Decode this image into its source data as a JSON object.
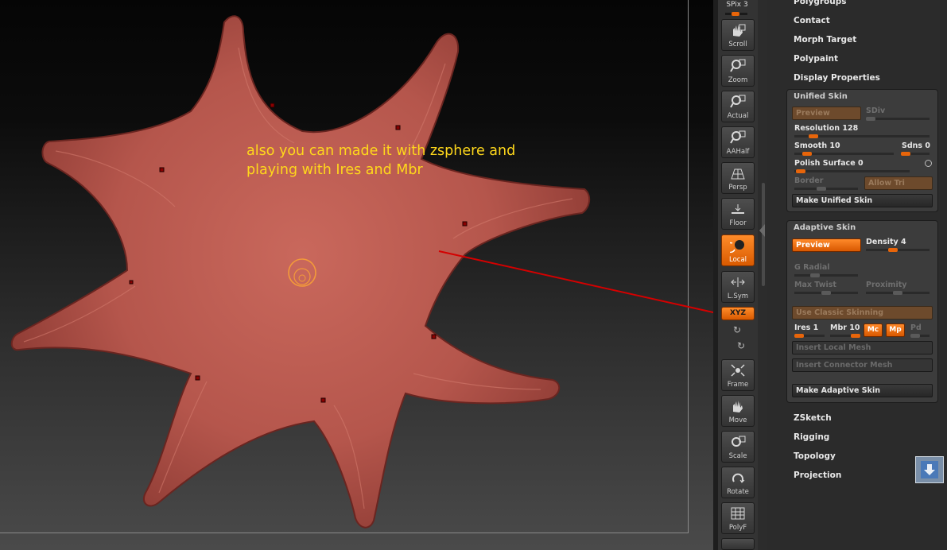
{
  "annotation": {
    "line1": "also you can made it with zsphere and",
    "line2": "playing with Ires and Mbr"
  },
  "colors": {
    "accent_orange": "#e8650a",
    "annotation_yellow": "#ffd81b",
    "arrow_red": "#d40000",
    "mesh_color": "#b5564c"
  },
  "shelf": {
    "spix": "SPix 3",
    "tools": [
      {
        "label": "Scroll",
        "icon": "hand-icon"
      },
      {
        "label": "Zoom",
        "icon": "zoom-icon"
      },
      {
        "label": "Actual",
        "icon": "zoom-icon"
      },
      {
        "label": "AAHalf",
        "icon": "zoom-icon"
      },
      {
        "label": "Persp",
        "icon": "grid-icon"
      },
      {
        "label": "Floor",
        "icon": "floor-icon"
      },
      {
        "label": "Local",
        "icon": "local-icon"
      },
      {
        "label": "L.Sym",
        "icon": "symmetry-icon"
      },
      {
        "label": "Frame",
        "icon": "frame-icon"
      },
      {
        "label": "Move",
        "icon": "hand-icon"
      },
      {
        "label": "Scale",
        "icon": "scale-icon"
      },
      {
        "label": "Rotate",
        "icon": "rotate-icon"
      },
      {
        "label": "PolyF",
        "icon": "polyframe-icon"
      }
    ],
    "xyz": "XYZ"
  },
  "menu_top": [
    "Polygroups",
    "Contact",
    "Morph Target",
    "Polypaint",
    "Display Properties"
  ],
  "unified_skin": {
    "title": "Unified Skin",
    "preview": "Preview",
    "sdiv": "SDiv",
    "resolution": "Resolution 128",
    "smooth": "Smooth 10",
    "sdns": "Sdns 0",
    "polish_surface": "Polish Surface 0",
    "border": "Border",
    "allow_tri": "Allow Tri",
    "make": "Make Unified Skin"
  },
  "adaptive_skin": {
    "title": "Adaptive Skin",
    "preview": "Preview",
    "density": "Density 4",
    "g_radial": "G Radial",
    "max_twist": "Max Twist",
    "proximity": "Proximity",
    "use_classic": "Use Classic Skinning",
    "ires": "Ires 1",
    "mbr": "Mbr 10",
    "mc": "Mc",
    "mp": "Mp",
    "pd": "Pd",
    "insert_local": "Insert Local Mesh",
    "insert_connector": "Insert Connector Mesh",
    "make": "Make Adaptive Skin"
  },
  "menu_bottom": [
    "ZSketch",
    "Rigging",
    "Topology",
    "Projection"
  ]
}
